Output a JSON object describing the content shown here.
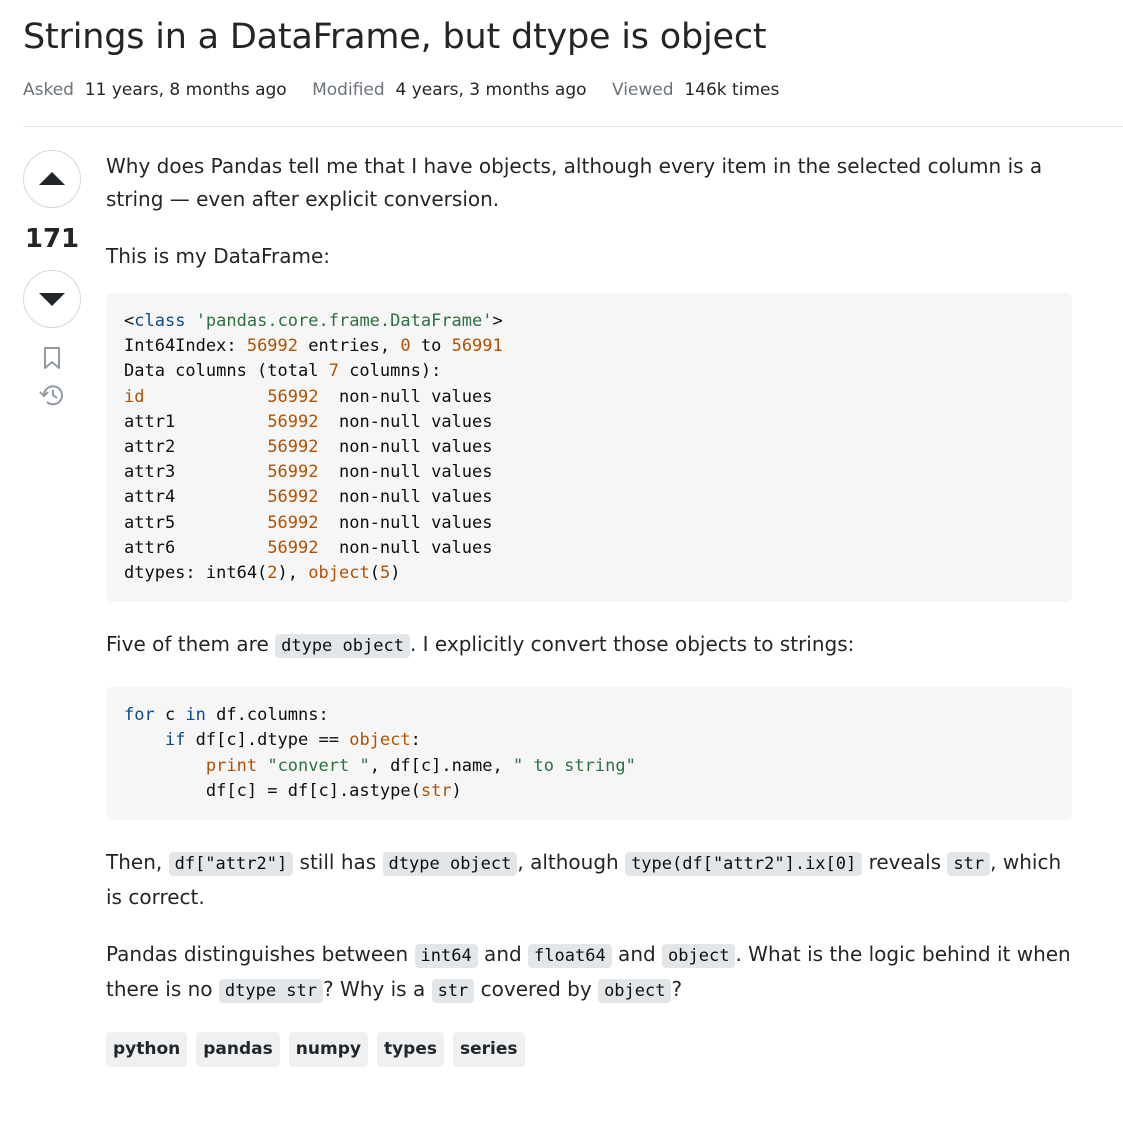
{
  "question": {
    "title": "Strings in a DataFrame, but dtype is object",
    "meta": {
      "asked_label": "Asked",
      "asked_value": "11 years, 8 months ago",
      "modified_label": "Modified",
      "modified_value": "4 years, 3 months ago",
      "viewed_label": "Viewed",
      "viewed_value": "146k times"
    },
    "votes": "171",
    "body": {
      "p1": "Why does Pandas tell me that I have objects, although every item in the selected column is a string — even after explicit conversion.",
      "p2": "This is my DataFrame:",
      "code1": {
        "l1a": "<",
        "l1b": "class",
        "l1c": " ",
        "l1d": "'pandas.core.frame.DataFrame'",
        "l1e": ">",
        "l2a": "Int64Index: ",
        "l2b": "56992",
        "l2c": " entries, ",
        "l2d": "0",
        "l2e": " to ",
        "l2f": "56991",
        "l3a": "Data columns (total ",
        "l3b": "7",
        "l3c": " columns):",
        "rows": [
          {
            "name": "id",
            "count": "56992",
            "rest": "  non-null values"
          },
          {
            "name": "attr1",
            "count": "56992",
            "rest": "  non-null values"
          },
          {
            "name": "attr2",
            "count": "56992",
            "rest": "  non-null values"
          },
          {
            "name": "attr3",
            "count": "56992",
            "rest": "  non-null values"
          },
          {
            "name": "attr4",
            "count": "56992",
            "rest": "  non-null values"
          },
          {
            "name": "attr5",
            "count": "56992",
            "rest": "  non-null values"
          },
          {
            "name": "attr6",
            "count": "56992",
            "rest": "  non-null values"
          }
        ],
        "l11a": "dtypes: int64(",
        "l11b": "2",
        "l11c": "), ",
        "l11d": "object",
        "l11e": "(",
        "l11f": "5",
        "l11g": ")"
      },
      "p3_a": "Five of them are ",
      "p3_code": "dtype object",
      "p3_b": ". I explicitly convert those objects to strings:",
      "code2": {
        "l1_for": "for",
        "l1_c": " c ",
        "l1_in": "in",
        "l1_rest": " df.columns:",
        "l2_ind": "    ",
        "l2_if": "if",
        "l2_a": " df[c].dtype == ",
        "l2_obj": "object",
        "l2_b": ":",
        "l3_ind": "        ",
        "l3_print": "print",
        "l3_sp": " ",
        "l3_s1": "\"convert \"",
        "l3_mid": ", df[c].name, ",
        "l3_s2": "\" to string\"",
        "l4_ind": "        ",
        "l4_a": "df[c] = df[c].astype(",
        "l4_str": "str",
        "l4_b": ")"
      },
      "p4_a": "Then, ",
      "p4_c1": "df[\"attr2\"]",
      "p4_b": " still has ",
      "p4_c2": "dtype object",
      "p4_c": ", although ",
      "p4_c3": "type(df[\"attr2\"].ix[0]",
      "p4_d": " reveals ",
      "p4_c4": "str",
      "p4_e": ", which is correct.",
      "p5_a": "Pandas distinguishes between ",
      "p5_c1": "int64",
      "p5_b": " and ",
      "p5_c2": "float64",
      "p5_c": " and ",
      "p5_c3": "object",
      "p5_d": ". What is the logic behind it when there is no ",
      "p5_c4": "dtype str",
      "p5_e": "? Why is a ",
      "p5_c5": "str",
      "p5_f": " covered by ",
      "p5_c6": "object",
      "p5_g": "?"
    },
    "tags": [
      "python",
      "pandas",
      "numpy",
      "types",
      "series"
    ],
    "icons": {
      "upvote": "arrow-up-icon",
      "downvote": "arrow-down-icon",
      "bookmark": "bookmark-icon",
      "history": "history-icon"
    },
    "colors": {
      "keyword": "#0c4a8c",
      "number": "#b35000",
      "string": "#2f6f44",
      "muted": "#6a737c"
    }
  }
}
